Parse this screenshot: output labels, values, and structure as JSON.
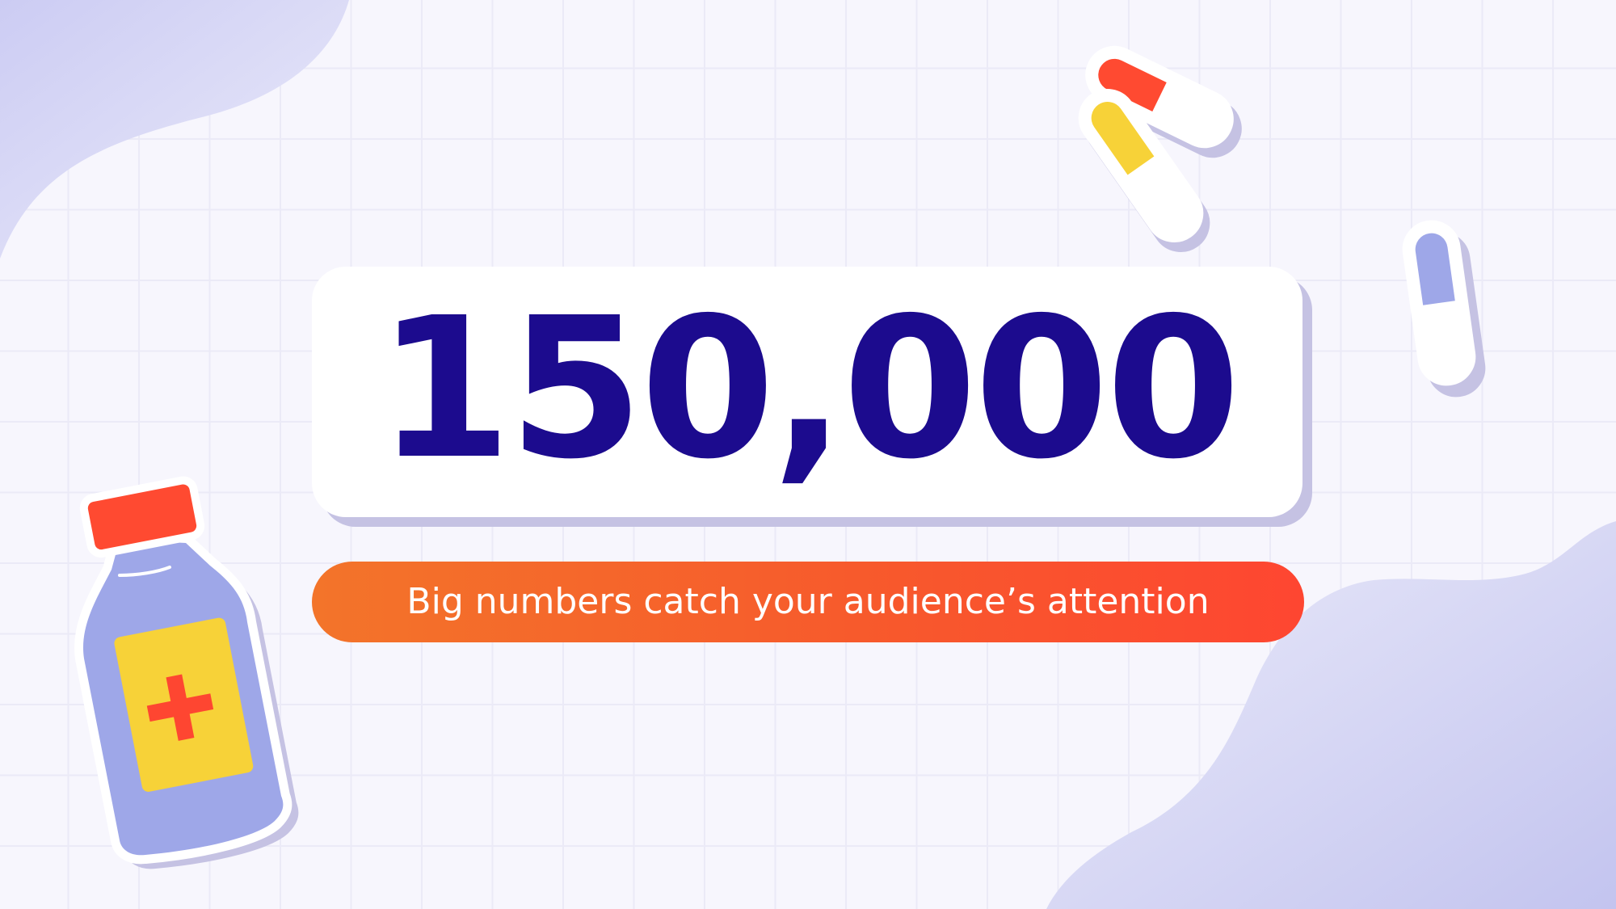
{
  "stat": {
    "value": "150,000",
    "caption": "Big numbers catch your audience’s attention"
  },
  "colors": {
    "background": "#f7f6fd",
    "grid_line": "#ebeaf7",
    "number_text": "#1c0b8e",
    "card": "#ffffff",
    "card_shadow": "#c5c2e3",
    "pill_gradient_start": "#f3742a",
    "pill_gradient_end": "#fe4631",
    "blob": "#d4d5f6",
    "bottle_body": "#9ea7e8",
    "bottle_cap": "#ff4a31",
    "label": "#f7d238",
    "cross": "#fe4631",
    "capsule_yellow": "#f7d238",
    "capsule_red": "#ff4a31",
    "capsule_blue": "#9ea7e8"
  },
  "decorations": {
    "top_left": "gradient-blob",
    "bottom_right": "gradient-blob",
    "bottom_left": "medicine-bottle-icon",
    "top_right": [
      "red-capsule-icon",
      "yellow-capsule-icon",
      "blue-capsule-icon"
    ]
  }
}
